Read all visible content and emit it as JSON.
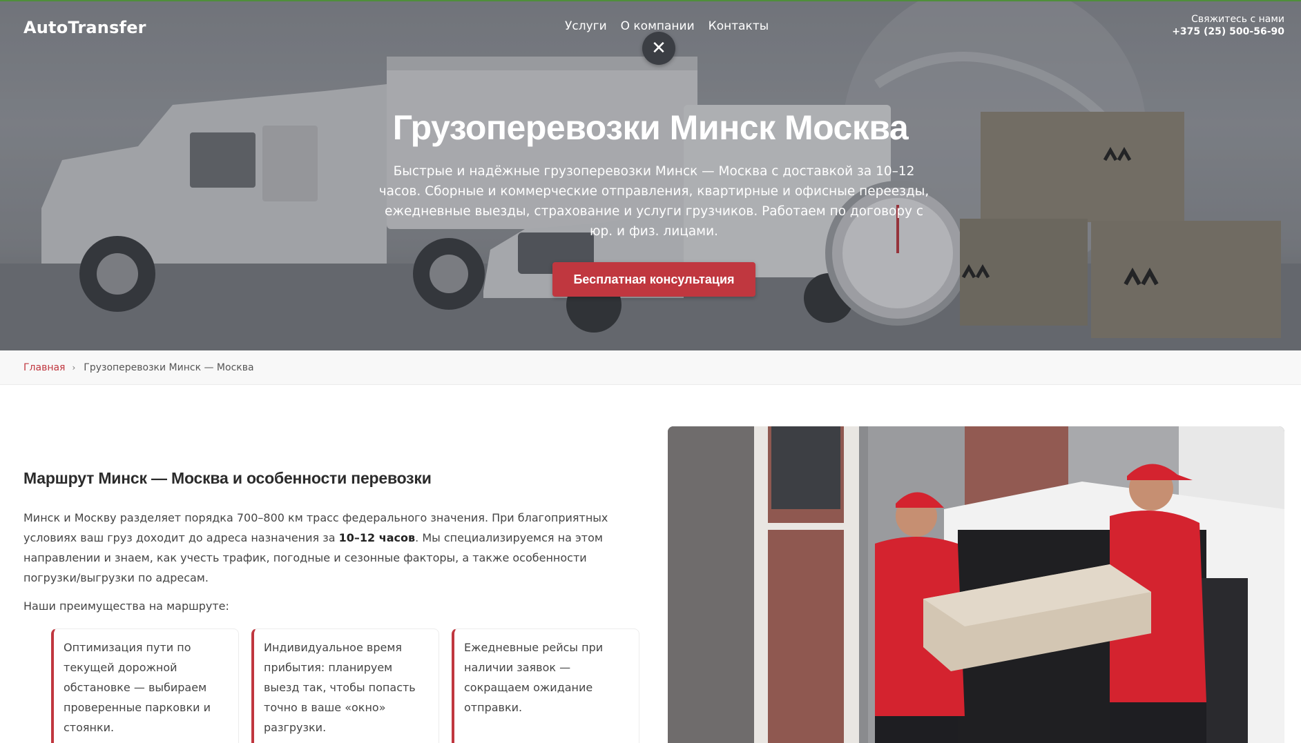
{
  "header": {
    "logo": "AutoTransfer",
    "nav": [
      "Услуги",
      "О компании",
      "Контакты"
    ],
    "contact_label": "Свяжитесь с нами",
    "phone": "+375 (25) 500-56-90"
  },
  "hero": {
    "title": "Грузоперевозки Минск Москва",
    "subtitle": "Быстрые и надёжные грузоперевозки Минск — Москва с доставкой за 10–12 часов. Сборные и коммерческие отправления, квартирные и офисные переезды, ежедневные выезды, страхование и услуги грузчиков. Работаем по договору с юр. и физ. лицами.",
    "cta": "Бесплатная консультация",
    "close_glyph": "✕"
  },
  "breadcrumb": {
    "home": "Главная",
    "separator": "›",
    "current": "Грузоперевозки Минск — Москва"
  },
  "section": {
    "title": "Маршрут Минск — Москва и особенности перевозки",
    "para_before": "Минск и Москву разделяет порядка 700–800 км трасс федерального значения. При благоприятных условиях ваш груз доходит до адреса назначения за ",
    "para_bold": "10–12 часов",
    "para_after": ". Мы специализируемся на этом направлении и знаем, как учесть трафик, погодные и сезонные факторы, а также особенности погрузки/выгрузки по адресам.",
    "advantages_label": "Наши преимущества на маршруте:",
    "cards": [
      "Оптимизация пути по текущей дорожной обстановке — выбираем проверенные парковки и стоянки.",
      "Индивидуальное время прибытия: планируем выезд так, чтобы попасть точно в ваше «окно» разгрузки.",
      "Ежедневные рейсы при наличии заявок — сокращаем ожидание отправки."
    ]
  },
  "colors": {
    "accent": "#c0373f",
    "top_border": "#4f8f3a"
  }
}
